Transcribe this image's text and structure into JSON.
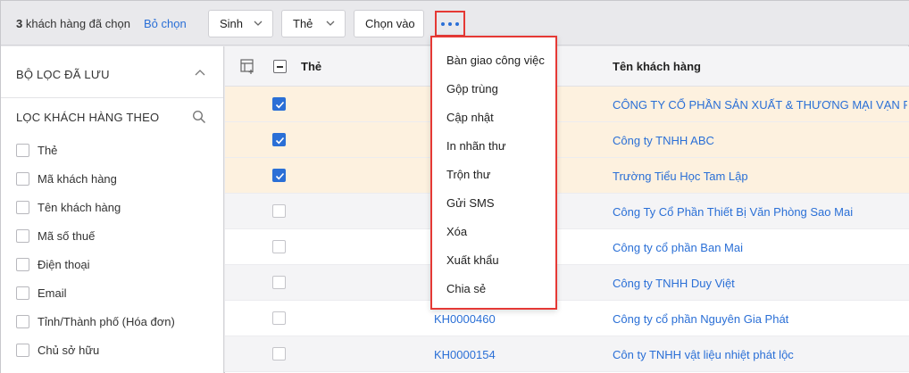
{
  "toolbar": {
    "selected_count": "3",
    "selected_text": " khách hàng đã chọn",
    "deselect_label": "Bỏ chọn",
    "buttons": [
      "Sinh",
      "Thẻ",
      "Chọn vào"
    ]
  },
  "sidebar": {
    "saved_filters_title": "BỘ LỌC ĐÃ LƯU",
    "filter_by_title": "LỌC KHÁCH HÀNG THEO",
    "items": [
      "Thẻ",
      "Mã khách hàng",
      "Tên khách hàng",
      "Mã số thuế",
      "Điện thoại",
      "Email",
      "Tỉnh/Thành phố (Hóa đơn)",
      "Chủ sở hữu"
    ]
  },
  "table": {
    "columns": [
      "Thẻ",
      "Tên khách hàng"
    ],
    "rows": [
      {
        "code": "",
        "name": "CÔNG TY CỔ PHẦN SẢN XUẤT & THƯƠNG MẠI VẠN PH...",
        "checked": true
      },
      {
        "code": "",
        "name": "Công ty TNHH ABC",
        "checked": true
      },
      {
        "code": "",
        "name": "Trường Tiểu Học Tam Lập",
        "checked": true
      },
      {
        "code": "",
        "name": "Công Ty Cổ Phần Thiết Bị Văn Phòng Sao Mai",
        "checked": false
      },
      {
        "code": "",
        "name": "Công ty cổ phần Ban Mai",
        "checked": false
      },
      {
        "code": "",
        "name": "Công ty TNHH Duy Việt",
        "checked": false
      },
      {
        "code": "KH0000460",
        "name": "Công ty cổ phần Nguyên Gia Phát",
        "checked": false
      },
      {
        "code": "KH0000154",
        "name": "Côn ty TNHH vật liệu nhiệt phát lộc",
        "checked": false
      }
    ]
  },
  "menu": {
    "items": [
      "Bàn giao công việc",
      "Gộp trùng",
      "Cập nhật",
      "In nhãn thư",
      "Trộn thư",
      "Gửi SMS",
      "Xóa",
      "Xuất khẩu",
      "Chia sẻ"
    ]
  },
  "colors": {
    "accent": "#2a6fd6",
    "highlight": "#e53935",
    "selected_row": "#fdf1df"
  }
}
